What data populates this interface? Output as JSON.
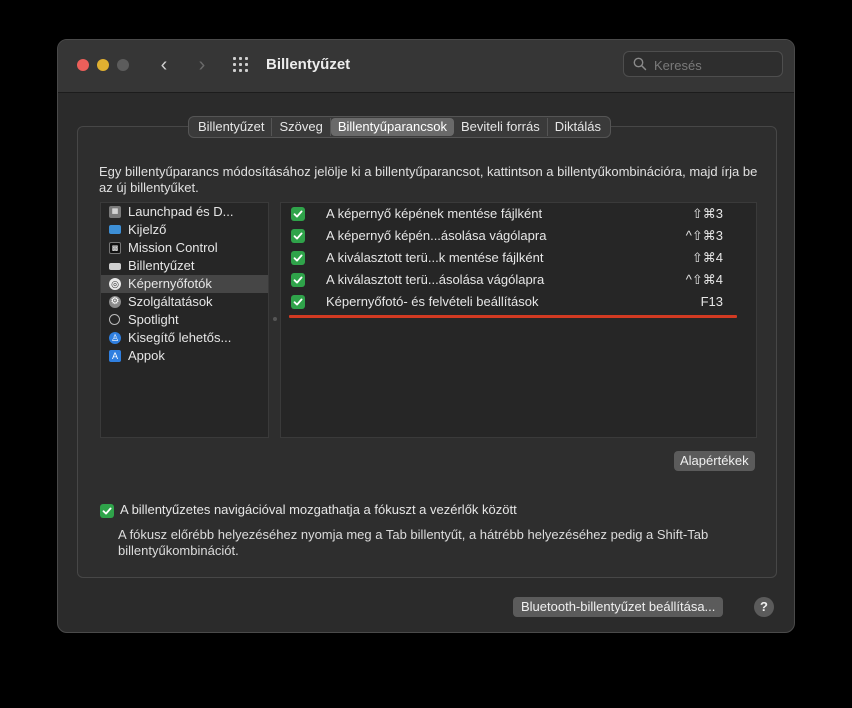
{
  "window": {
    "title": "Billentyűzet"
  },
  "search": {
    "placeholder": "Keresés"
  },
  "tabs": [
    {
      "label": "Billentyűzet"
    },
    {
      "label": "Szöveg"
    },
    {
      "label": "Billentyűparancsok",
      "active": true
    },
    {
      "label": "Beviteli forrás"
    },
    {
      "label": "Diktálás"
    }
  ],
  "instructions": "Egy billentyűparancs módosításához jelölje ki a billentyűparancsot, kattintson a billentyűkombinációra, majd írja be az új billentyűket.",
  "sidebar": {
    "items": [
      {
        "label": "Launchpad és D...",
        "icon": "launchpad-icon"
      },
      {
        "label": "Kijelző",
        "icon": "display-icon"
      },
      {
        "label": "Mission Control",
        "icon": "mission-control-icon"
      },
      {
        "label": "Billentyűzet",
        "icon": "keyboard-icon"
      },
      {
        "label": "Képernyőfotók",
        "icon": "screenshot-icon",
        "selected": true
      },
      {
        "label": "Szolgáltatások",
        "icon": "gear-icon"
      },
      {
        "label": "Spotlight",
        "icon": "spotlight-icon"
      },
      {
        "label": "Kisegítő lehetős...",
        "icon": "accessibility-icon"
      },
      {
        "label": "Appok",
        "icon": "app-store-icon"
      }
    ]
  },
  "shortcuts": [
    {
      "label": "A képernyő képének mentése fájlként",
      "key": "⇧⌘3",
      "checked": true
    },
    {
      "label": "A képernyő képén...ásolása vágólapra",
      "key": "^⇧⌘3",
      "checked": true
    },
    {
      "label": "A kiválasztott terü...k mentése fájlként",
      "key": "⇧⌘4",
      "checked": true
    },
    {
      "label": "A kiválasztott terü...ásolása vágólapra",
      "key": "^⇧⌘4",
      "checked": true
    },
    {
      "label": "Képernyőfotó- és felvételi beállítások",
      "key": "F13",
      "checked": true
    }
  ],
  "buttons": {
    "defaults": "Alapértékek",
    "bluetooth": "Bluetooth-billentyűzet beállítása...",
    "help": "?"
  },
  "keyboard_nav": {
    "checked": true,
    "label": "A billentyűzetes navigációval mozgathatja a fókuszt a vezérlők között",
    "description": "A fókusz előrébb helyezéséhez nyomja meg a Tab billentyűt, a hátrébb helyezéséhez pedig a Shift-Tab billentyűkombinációt."
  },
  "colors": {
    "accent_green": "#2fa34a",
    "highlight_red": "#d23a22"
  }
}
